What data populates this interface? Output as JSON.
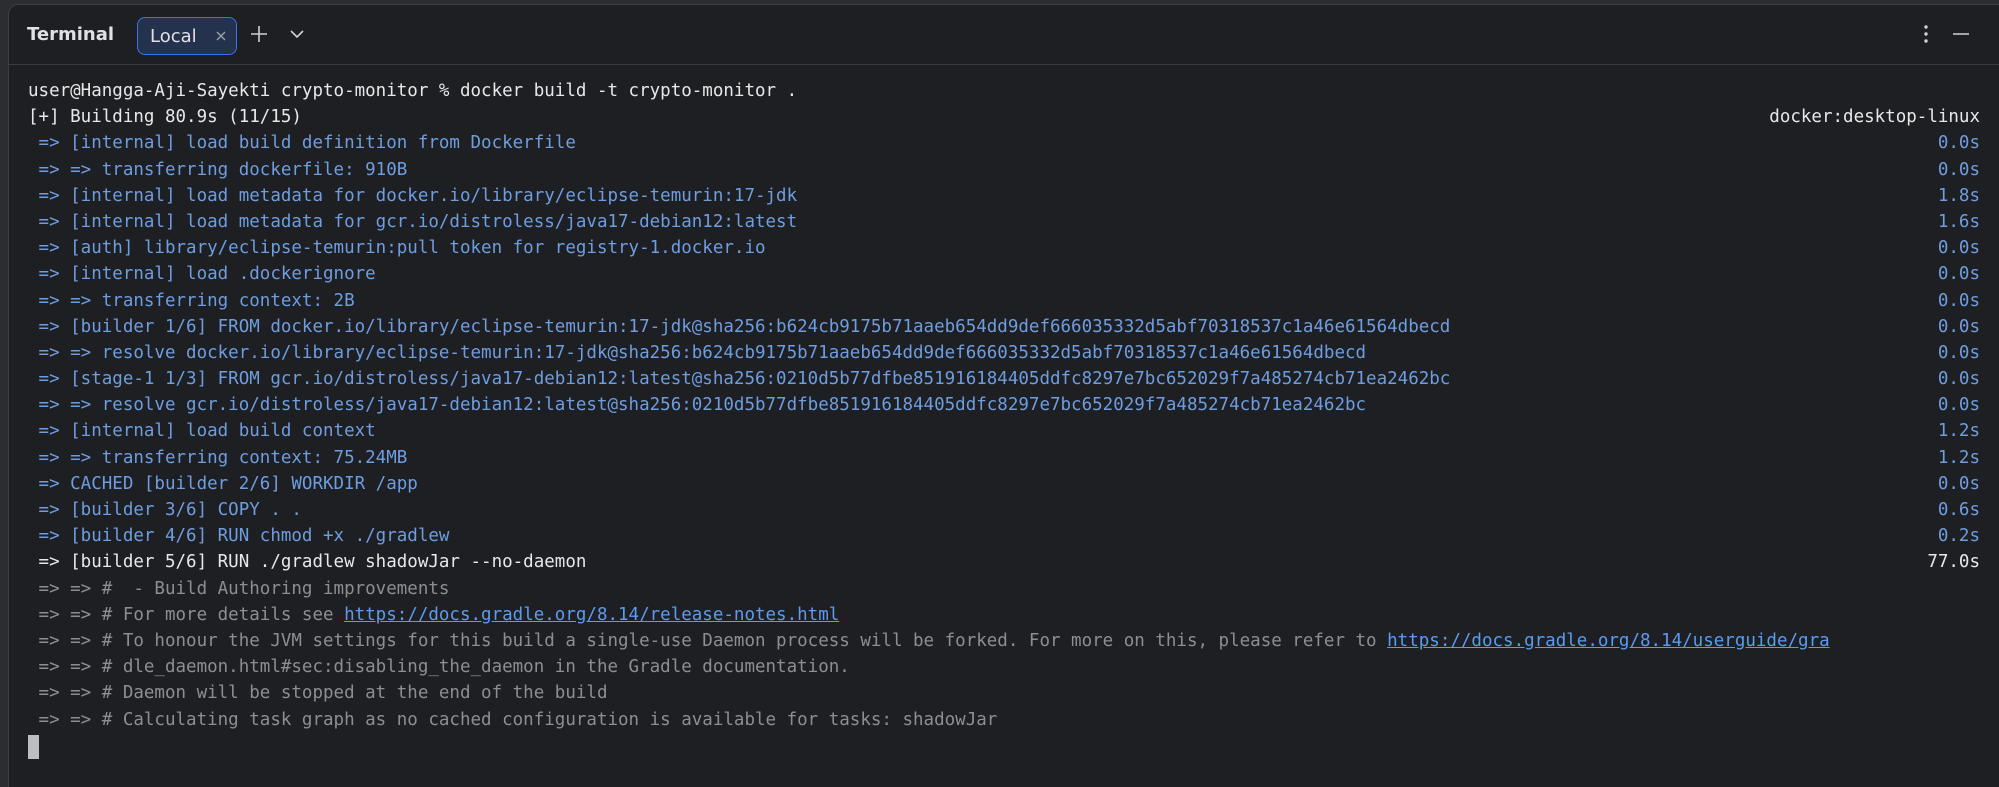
{
  "header": {
    "title": "Terminal",
    "tab_label": "Local",
    "icons": {
      "close_tab": "close-icon",
      "new_tab": "plus-icon",
      "dropdown": "chevron-down-icon",
      "options": "more-vertical-icon",
      "hide": "minimize-icon"
    }
  },
  "terminal": {
    "prompt": "user@Hangga-Aji-Sayekti crypto-monitor % docker build -t crypto-monitor .",
    "status": {
      "text": "[+] Building 80.9s (11/15)",
      "right": "docker:desktop-linux"
    },
    "steps": [
      {
        "text": " => [internal] load build definition from Dockerfile",
        "time": "0.0s"
      },
      {
        "text": " => => transferring dockerfile: 910B",
        "time": "0.0s"
      },
      {
        "text": " => [internal] load metadata for docker.io/library/eclipse-temurin:17-jdk",
        "time": "1.8s"
      },
      {
        "text": " => [internal] load metadata for gcr.io/distroless/java17-debian12:latest",
        "time": "1.6s"
      },
      {
        "text": " => [auth] library/eclipse-temurin:pull token for registry-1.docker.io",
        "time": "0.0s"
      },
      {
        "text": " => [internal] load .dockerignore",
        "time": "0.0s"
      },
      {
        "text": " => => transferring context: 2B",
        "time": "0.0s"
      },
      {
        "text": " => [builder 1/6] FROM docker.io/library/eclipse-temurin:17-jdk@sha256:b624cb9175b71aaeb654dd9def666035332d5abf70318537c1a46e61564dbecd",
        "time": "0.0s"
      },
      {
        "text": " => => resolve docker.io/library/eclipse-temurin:17-jdk@sha256:b624cb9175b71aaeb654dd9def666035332d5abf70318537c1a46e61564dbecd",
        "time": "0.0s"
      },
      {
        "text": " => [stage-1 1/3] FROM gcr.io/distroless/java17-debian12:latest@sha256:0210d5b77dfbe851916184405ddfc8297e7bc652029f7a485274cb71ea2462bc",
        "time": "0.0s"
      },
      {
        "text": " => => resolve gcr.io/distroless/java17-debian12:latest@sha256:0210d5b77dfbe851916184405ddfc8297e7bc652029f7a485274cb71ea2462bc",
        "time": "0.0s"
      },
      {
        "text": " => [internal] load build context",
        "time": "1.2s"
      },
      {
        "text": " => => transferring context: 75.24MB",
        "time": "1.2s"
      },
      {
        "text": " => CACHED [builder 2/6] WORKDIR /app",
        "time": "0.0s"
      },
      {
        "text": " => [builder 3/6] COPY . .",
        "time": "0.6s"
      },
      {
        "text": " => [builder 4/6] RUN chmod +x ./gradlew",
        "time": "0.2s"
      }
    ],
    "active_step": {
      "text": " => [builder 5/6] RUN ./gradlew shadowJar --no-daemon",
      "time": "77.0s"
    },
    "log": {
      "line1": " => => #  - Build Authoring improvements",
      "line2_pre": " => => # For more details see ",
      "line2_link": "https://docs.gradle.org/8.14/release-notes.html",
      "line3_pre": " => => # To honour the JVM settings for this build a single-use Daemon process will be forked. For more on this, please refer to ",
      "line3_link": "https://docs.gradle.org/8.14/userguide/gra",
      "line4": " => => # dle_daemon.html#sec:disabling_the_daemon in the Gradle documentation.",
      "line5": " => => # Daemon will be stopped at the end of the build",
      "line6": " => => # Calculating task graph as no cached configuration is available for tasks: shadowJar"
    }
  },
  "colors": {
    "background": "#1e1f22",
    "step_blue": "#6e9de0",
    "log_gray": "#8b8f94",
    "link": "#5c9bf0",
    "tab_border": "#3574f0"
  }
}
